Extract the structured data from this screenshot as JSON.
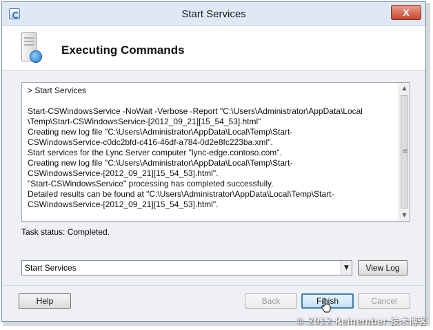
{
  "window": {
    "title": "Start Services",
    "close_label": "X"
  },
  "header": {
    "title": "Executing Commands"
  },
  "log": {
    "lines": [
      "> Start Services",
      "",
      "Start-CSWindowsService -NoWait -Verbose -Report \"C:\\Users\\Administrator\\AppData\\Local",
      "\\Temp\\Start-CSWindowsService-[2012_09_21][15_54_53].html\"",
      "Creating new log file \"C:\\Users\\Administrator\\AppData\\Local\\Temp\\Start-",
      "CSWindowsService-c0dc2bfd-c416-46df-a784-0d2e8fc223ba.xml\".",
      "Start services for the Lync Server computer \"lync-edge.contoso.com\".",
      "Creating new log file \"C:\\Users\\Administrator\\AppData\\Local\\Temp\\Start-",
      "CSWindowsService-[2012_09_21][15_54_53].html\".",
      "\"Start-CSWindowsService\" processing has completed successfully.",
      "Detailed results can be found at \"C:\\Users\\Administrator\\AppData\\Local\\Temp\\Start-",
      "CSWindowsService-[2012_09_21][15_54_53].html\"."
    ]
  },
  "task_status": "Task status: Completed.",
  "combo": {
    "selected": "Start Services"
  },
  "buttons": {
    "view_log": "View Log",
    "help": "Help",
    "back": "Back",
    "finish": "Finish",
    "cancel": "Cancel"
  },
  "watermark": "© 2012 Reinember 技术博客",
  "colors": {
    "titlebar": "#dfe9f5",
    "close": "#c7452f",
    "default_button_border": "#3c7fb1"
  }
}
